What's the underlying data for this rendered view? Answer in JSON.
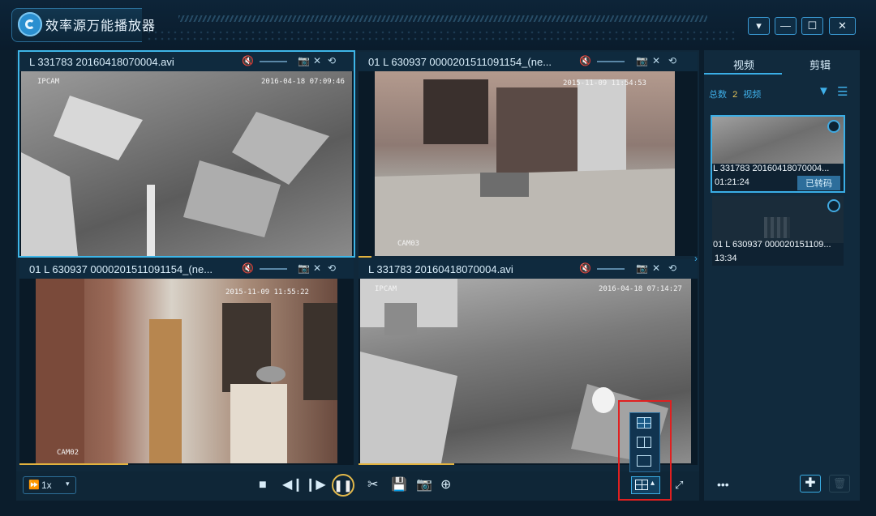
{
  "app": {
    "title": "效率源万能播放器"
  },
  "window_buttons": [
    {
      "glyph": "▾"
    },
    {
      "glyph": "—"
    },
    {
      "glyph": "☐"
    },
    {
      "glyph": "✕"
    }
  ],
  "panes": [
    {
      "name": "L 331783 20160418070004.avi",
      "osd_top_left": "IPCAM",
      "osd_time": "2016-04-18 07:09:46",
      "osd_cam": "",
      "active": true
    },
    {
      "name": "01 L 630937 0000201511091154_(ne...",
      "osd_top_left": "",
      "osd_time": "2015-11-09 11:54:53",
      "osd_cam": "CAM03",
      "active": false
    },
    {
      "name": "01 L 630937 0000201511091154_(ne...",
      "osd_top_left": "",
      "osd_time": "2015-11-09 11:55:22",
      "osd_cam": "CAM02",
      "active": false
    },
    {
      "name": "L 331783 20160418070004.avi",
      "osd_top_left": "IPCAM",
      "osd_time": "2016-04-18 07:14:27",
      "osd_cam": "",
      "active": false
    }
  ],
  "toolbar": {
    "speed": "1x"
  },
  "sidebar": {
    "tabs": [
      "视频",
      "剪辑"
    ],
    "count_label": "总数",
    "count_value": "2",
    "count_unit": "视频",
    "items": [
      {
        "name": "L 331783 20160418070004...",
        "duration": "01:21:24",
        "badge": "已转码"
      },
      {
        "name": "01 L 630937 000020151109...",
        "duration": "13:34",
        "badge": ""
      }
    ],
    "more": "•••"
  }
}
